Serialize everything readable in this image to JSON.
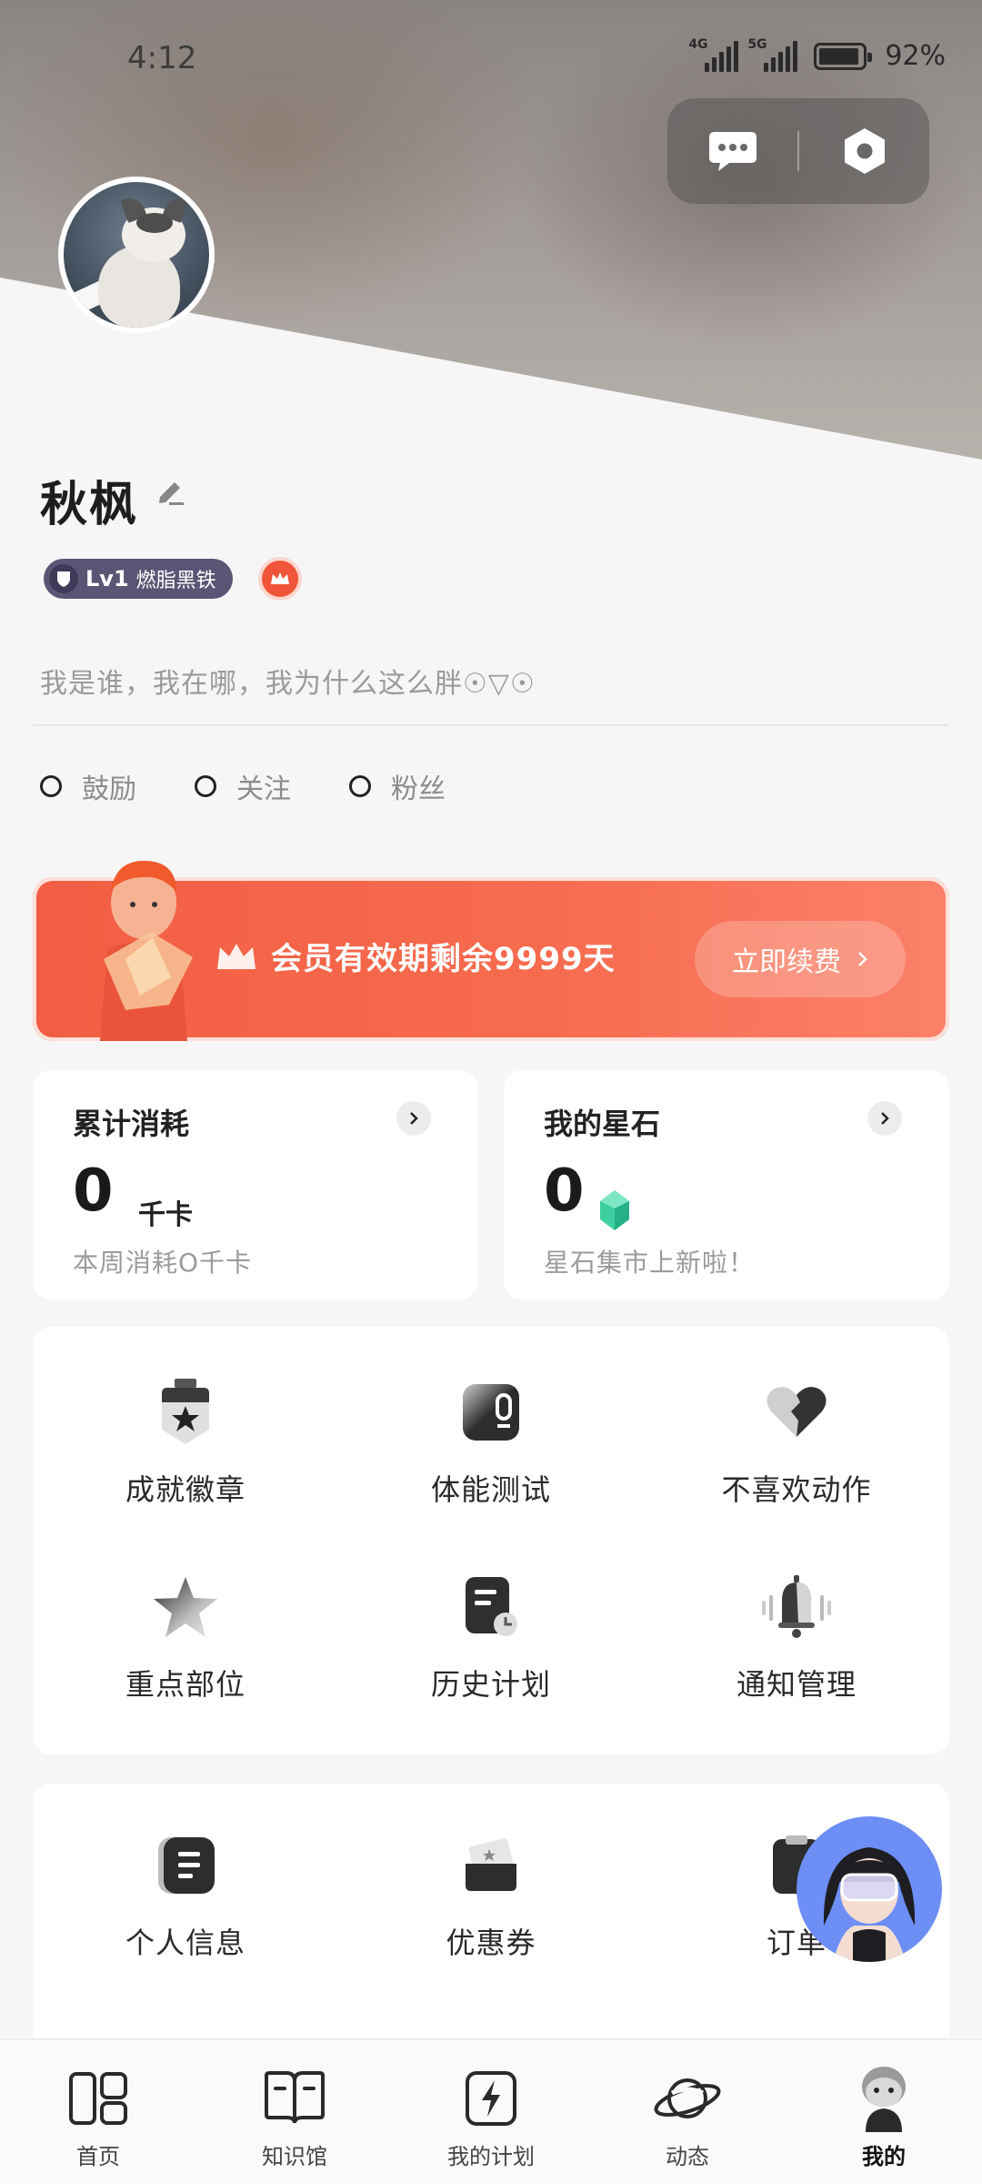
{
  "status_bar": {
    "time": "4:12",
    "network_1": "4G",
    "network_2": "5G",
    "battery_percent": "92%"
  },
  "profile": {
    "name": "秋枫",
    "level": "Lv1",
    "level_title": "燃脂黑铁",
    "bio": "我是谁，我在哪，我为什么这么胖☉▽☉",
    "stats": [
      {
        "label": "鼓励"
      },
      {
        "label": "关注"
      },
      {
        "label": "粉丝"
      }
    ]
  },
  "vip": {
    "text": "会员有效期剩余9999天",
    "button": "立即续费"
  },
  "cards": {
    "consumption": {
      "title": "累计消耗",
      "value": "0",
      "unit": "千卡",
      "sub": "本周消耗O千卡"
    },
    "stars": {
      "title": "我的星石",
      "value": "0",
      "sub": "星石集市上新啦！"
    }
  },
  "menu_1": [
    {
      "label": "成就徽章",
      "icon": "badge-icon"
    },
    {
      "label": "体能测试",
      "icon": "fitness-test-icon"
    },
    {
      "label": "不喜欢动作",
      "icon": "broken-heart-icon"
    },
    {
      "label": "重点部位",
      "icon": "star-icon"
    },
    {
      "label": "历史计划",
      "icon": "history-plan-icon"
    },
    {
      "label": "通知管理",
      "icon": "bell-icon"
    }
  ],
  "menu_2": [
    {
      "label": "个人信息",
      "icon": "personal-info-icon"
    },
    {
      "label": "优惠券",
      "icon": "coupon-icon"
    },
    {
      "label": "订单",
      "icon": "order-icon"
    }
  ],
  "bottom_nav": [
    {
      "label": "首页",
      "icon": "home-icon"
    },
    {
      "label": "知识馆",
      "icon": "book-icon"
    },
    {
      "label": "我的计划",
      "icon": "plan-icon"
    },
    {
      "label": "动态",
      "icon": "planet-icon"
    },
    {
      "label": "我的",
      "icon": "profile-icon",
      "active": true
    }
  ],
  "colors": {
    "accent": "#f25e43",
    "level_badge": "#5a5574",
    "gem": "#3ccfa0",
    "assistant_bg": "#6d8ef5"
  }
}
